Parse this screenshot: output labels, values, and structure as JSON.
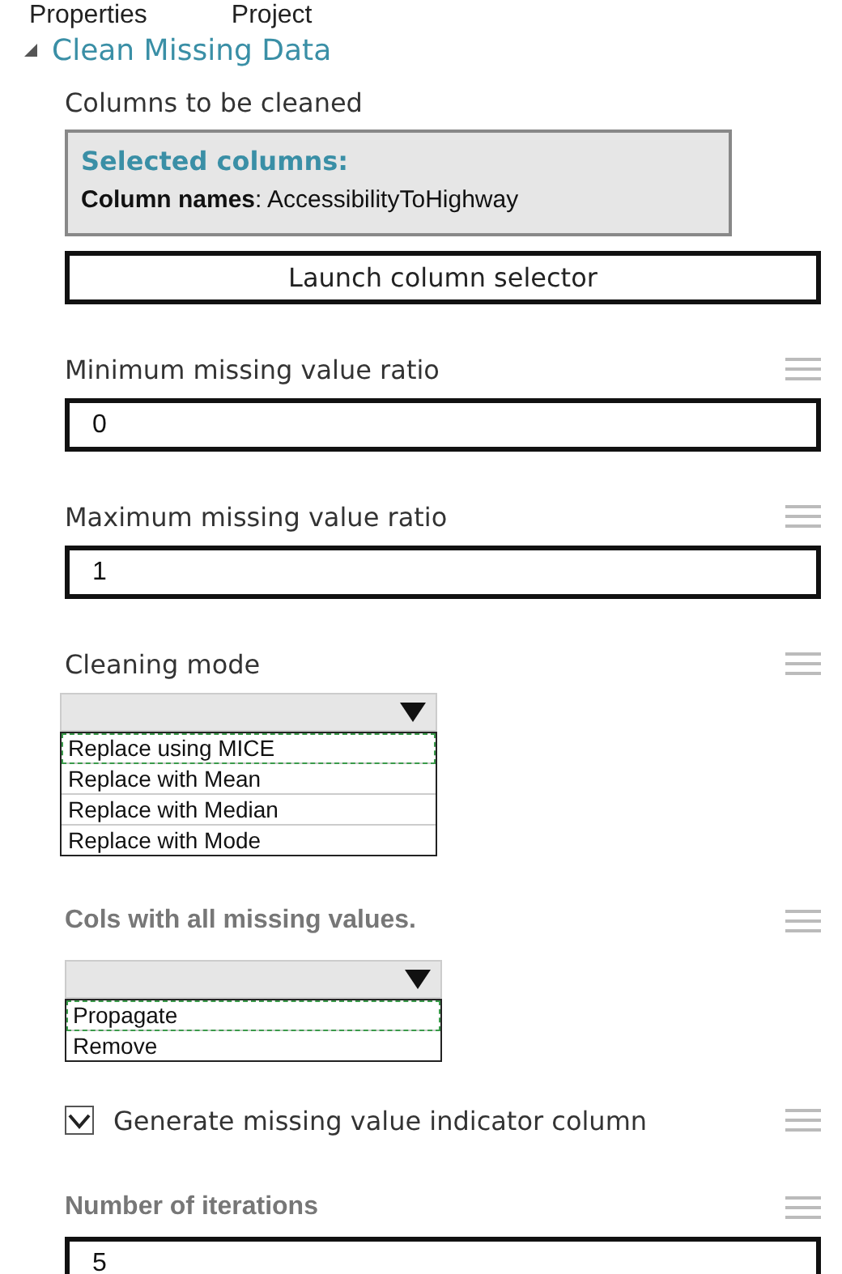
{
  "tabs": [
    {
      "label": "Properties"
    },
    {
      "label": "Project"
    }
  ],
  "section": {
    "title": "Clean Missing Data",
    "expanded": true
  },
  "column_picker": {
    "label": "Columns to be cleaned",
    "heading": "Selected columns:",
    "names": "**Column names**: AccessibilityToHighway",
    "button": "Launch column selector"
  },
  "fields": [
    {
      "kind": "number",
      "label": "Minimum missing value ratio",
      "label_bold": false,
      "value": "0"
    },
    {
      "kind": "number",
      "label": "Maximum missing value ratio",
      "label_bold": false,
      "value": "1"
    },
    {
      "kind": "dropdown",
      "label": "Cleaning mode",
      "label_bold": false,
      "options": [
        {
          "label": "Replace using MICE",
          "selected": true
        },
        {
          "label": "Replace with Mean",
          "selected": false
        },
        {
          "label": "Replace with Median",
          "selected": false
        },
        {
          "label": "Replace with Mode",
          "selected": false
        }
      ]
    },
    {
      "kind": "dropdown",
      "label": "Cols with all missing values.",
      "label_bold": true,
      "options": [
        {
          "label": "Propagate",
          "selected": true
        },
        {
          "label": "Remove",
          "selected": false
        }
      ]
    },
    {
      "kind": "checkbox",
      "label": "Generate missing value indicator column",
      "checked": true
    },
    {
      "kind": "number",
      "label": "Number of iterations",
      "label_bold": true,
      "value": "5"
    }
  ]
}
